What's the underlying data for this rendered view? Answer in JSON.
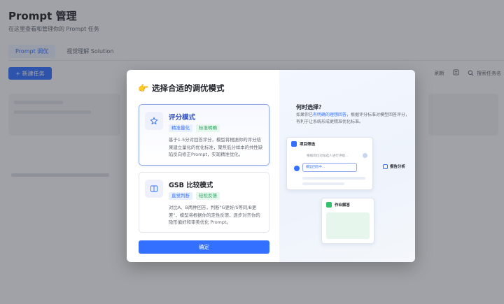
{
  "page": {
    "title": "Prompt 管理",
    "subtitle": "在这里查看和管理你的 Prompt 任务",
    "tabs": [
      {
        "label": "Prompt 调优",
        "active": true
      },
      {
        "label": "视觉理解 Solution",
        "active": false
      }
    ],
    "new_task_label": "+ 新建任务",
    "toolbar": {
      "refresh_label": "刷新",
      "search_label": "搜索任务名"
    }
  },
  "modal": {
    "title": "选择合适的调优模式",
    "modes": [
      {
        "name": "评分模式",
        "tags": [
          "精准量化",
          "标准明确"
        ],
        "description": "基于1-5分对回答评分，模型将根据你的评分结果建立量化的优化标准，聚焦低分样本的共性缺陷反向修正Prompt，实现精准优化。",
        "selected": true,
        "icon": "star-icon"
      },
      {
        "name": "GSB 比较模式",
        "tags": [
          "直觉判断",
          "轻松反馈"
        ],
        "description": "对比A、B两种回答，判断\"G更好/S等同/B更差\"，模型将根据你的定性反馈，逐步对齐你的隐形偏好和审美优化 Prompt。",
        "selected": false,
        "icon": "book-icon"
      }
    ],
    "confirm_label": "确定",
    "help": {
      "title": "何时选择？",
      "desc_prefix": "如果你已",
      "desc_highlight": "有明确的理想回答",
      "desc_suffix": "，根据评分标准对模型回答评分，有利于让系统形成更精准优化标准。",
      "illustration": {
        "card1_title": "项目筛选",
        "card1_field1": "根据岗位对候选人进行评级...",
        "card1_field2": "模型回答中...",
        "side_label": "报告分析",
        "card2_title": "作业解答"
      }
    }
  },
  "colors": {
    "accent": "#3370ff",
    "tag_green": "#2ea564",
    "overlay": "rgba(40,44,52,0.42)"
  }
}
